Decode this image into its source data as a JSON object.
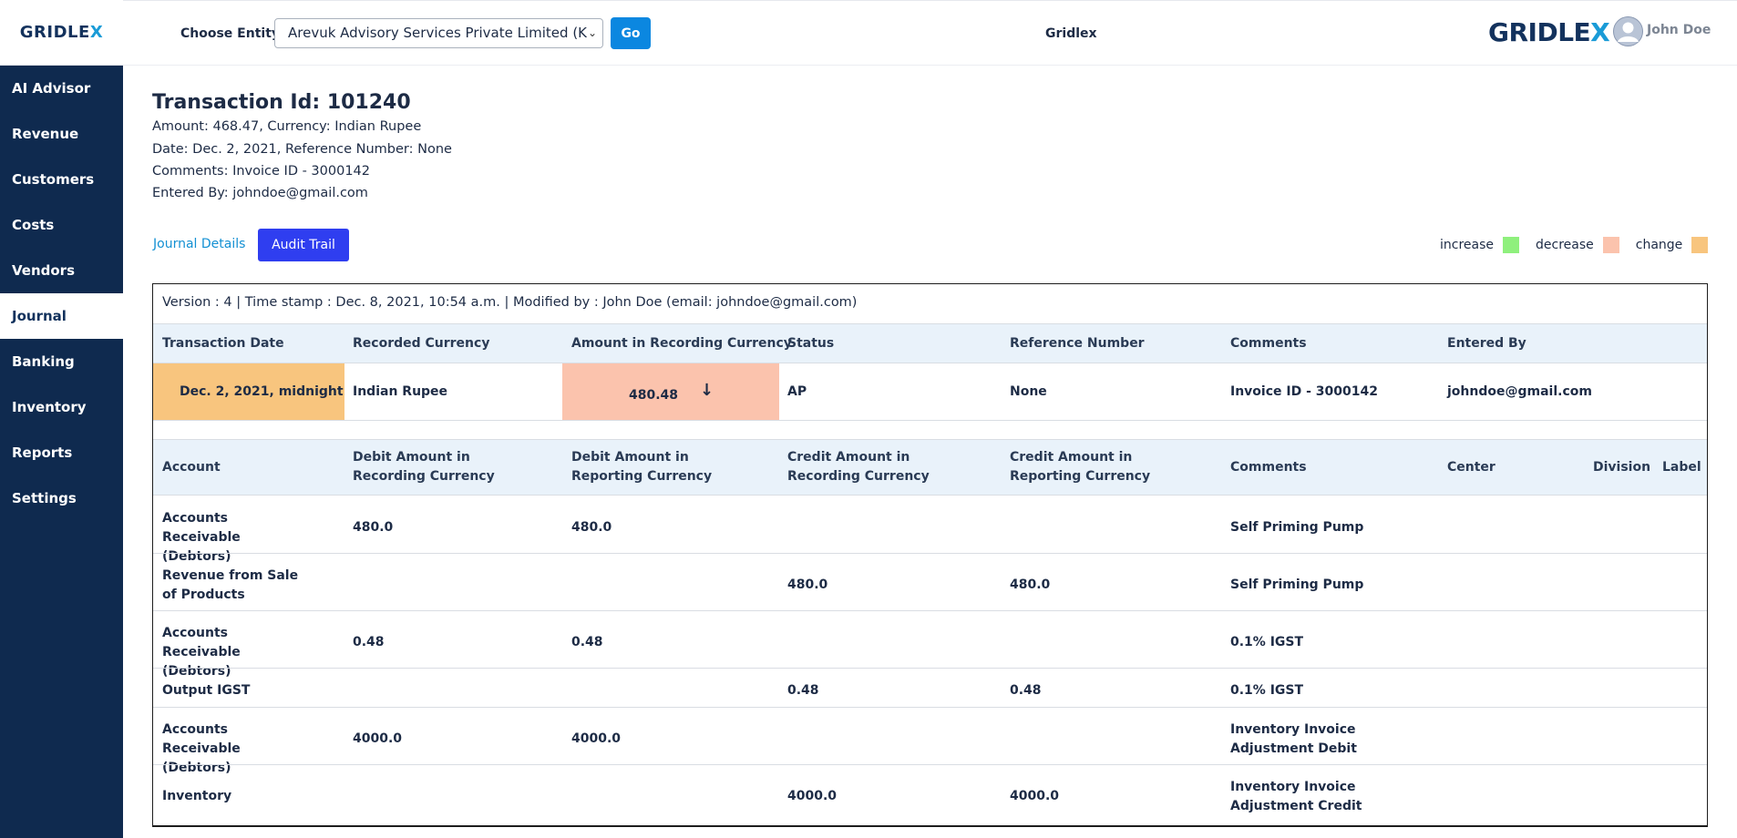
{
  "sidebar": {
    "logo": "GRIDLEX",
    "items": [
      {
        "label": "AI Advisor"
      },
      {
        "label": "Revenue"
      },
      {
        "label": "Customers"
      },
      {
        "label": "Costs"
      },
      {
        "label": "Vendors"
      },
      {
        "label": "Journal",
        "active": true
      },
      {
        "label": "Banking"
      },
      {
        "label": "Inventory"
      },
      {
        "label": "Reports"
      },
      {
        "label": "Settings"
      }
    ]
  },
  "topbar": {
    "entity_label": "Choose Entity",
    "entity_value": "Arevuk Advisory Services Private Limited (K",
    "go_label": "Go",
    "center_text": "Gridlex",
    "brand": "GRIDLEX",
    "user_name": "John Doe"
  },
  "transaction": {
    "title": "Transaction Id: 101240",
    "line1": "Amount: 468.47,   Currency: Indian Rupee",
    "line2": "Date: Dec. 2, 2021,   Reference Number: None",
    "line3": "Comments: Invoice ID - 3000142",
    "line4": "Entered By: johndoe@gmail.com"
  },
  "tabs": {
    "journal": "Journal Details",
    "audit": "Audit Trail"
  },
  "legend": {
    "increase": "increase",
    "decrease": "decrease",
    "change": "change",
    "colors": {
      "increase": "#8ff07d",
      "decrease": "#fbc3ad",
      "change": "#f8c57e"
    }
  },
  "version_line": "Version : 4   |   Time stamp : Dec. 8, 2021, 10:54 a.m.   |   Modified by : John Doe (email: johndoe@gmail.com)",
  "summary": {
    "headers": [
      "Transaction Date",
      "Recorded Currency",
      "Amount in Recording Currency",
      "Status",
      "Reference Number",
      "Comments",
      "Entered By"
    ],
    "row": [
      "Dec. 2, 2021, midnight",
      "Indian Rupee",
      "480.48",
      "AP",
      "None",
      "Invoice ID - 3000142",
      "johndoe@gmail.com"
    ],
    "amount_arrow": "↓"
  },
  "lines": {
    "headers": [
      "Account",
      "Debit Amount in Recording Currency",
      "Debit Amount in Reporting Currency",
      "Credit Amount in Recording Currency",
      "Credit Amount in Reporting Currency",
      "Comments",
      "Center",
      "Division",
      "Label"
    ],
    "rows": [
      [
        "Accounts Receivable (Debtors)",
        "480.0",
        "480.0",
        "",
        "",
        "Self Priming Pump"
      ],
      [
        "Revenue from Sale of Products",
        "",
        "",
        "480.0",
        "480.0",
        "Self Priming Pump"
      ],
      [
        "Accounts Receivable (Debtors)",
        "0.48",
        "0.48",
        "",
        "",
        "0.1% IGST"
      ],
      [
        "Output IGST",
        "",
        "",
        "0.48",
        "0.48",
        "0.1% IGST"
      ],
      [
        "Accounts Receivable (Debtors)",
        "4000.0",
        "4000.0",
        "",
        "",
        "Inventory Invoice Adjustment Debit"
      ],
      [
        "Inventory",
        "",
        "",
        "4000.0",
        "4000.0",
        "Inventory Invoice Adjustment Credit"
      ]
    ]
  }
}
